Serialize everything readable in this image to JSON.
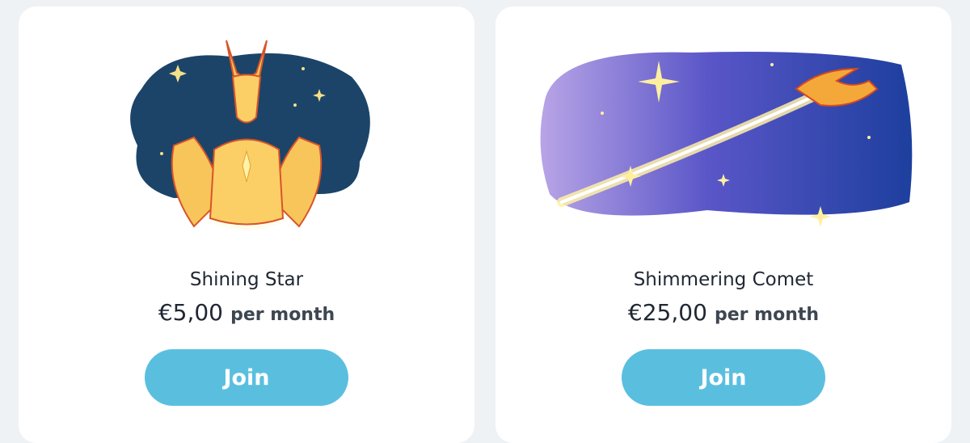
{
  "tiers": [
    {
      "name": "Shining Star",
      "price": "€5,00",
      "period": "per month",
      "button_label": "Join",
      "image_icon": "dragon-star-illustration"
    },
    {
      "name": "Shimmering Comet",
      "price": "€25,00",
      "period": "per month",
      "button_label": "Join",
      "image_icon": "comet-dragon-illustration"
    }
  ],
  "colors": {
    "background": "#eef2f5",
    "card": "#ffffff",
    "button": "#5abfdf",
    "button_text": "#ffffff",
    "text": "#1f2733"
  }
}
